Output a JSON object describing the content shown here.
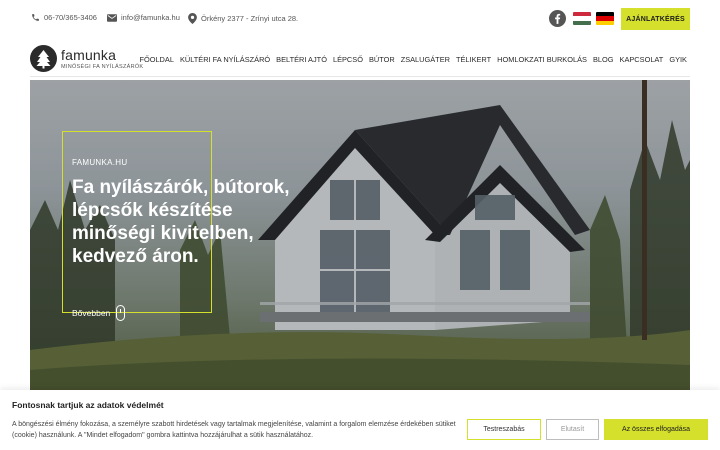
{
  "topbar": {
    "phone": "06-70/365-3406",
    "email": "info@famunka.hu",
    "address": "Örkény 2377 - Zrínyi utca 28.",
    "quote_button": "AJÁNLATKÉRÉS",
    "accent_color": "#d4e02b"
  },
  "brand": {
    "name": "famunka",
    "tagline": "MINŐSÉGI FA NYÍLÁSZÁRÓK"
  },
  "nav": {
    "items": [
      "FŐOLDAL",
      "KÜLTÉRI FA NYÍLÁSZÁRÓ",
      "BELTÉRI AJTÓ",
      "LÉPCSŐ",
      "BÚTOR",
      "ZSALUGÁTER",
      "TÉLIKERT",
      "HOMLOKZATI BURKOLÁS",
      "BLOG",
      "KAPCSOLAT",
      "GYIK"
    ]
  },
  "hero": {
    "eyebrow": "FAMUNKA.HU",
    "title_lines": [
      "Fa nyílászárók, bútorok,",
      "lépcsők készítése",
      "minőségi kivitelben,",
      "kedvező áron."
    ],
    "more_label": "Bővebben"
  },
  "cookie": {
    "title": "Fontosnak tartjuk az adatok védelmét",
    "text": "A böngészési élmény fokozása, a személyre szabott hirdetések vagy tartalmak megjelenítése, valamint a forgalom elemzése érdekében sütiket (cookie) használunk. A \"Mindet elfogadom\" gombra kattintva hozzájárulhat a sütik használatához.",
    "settings_label": "Testreszabás",
    "reject_label": "Elutasít",
    "accept_label": "Az összes elfogadása"
  }
}
